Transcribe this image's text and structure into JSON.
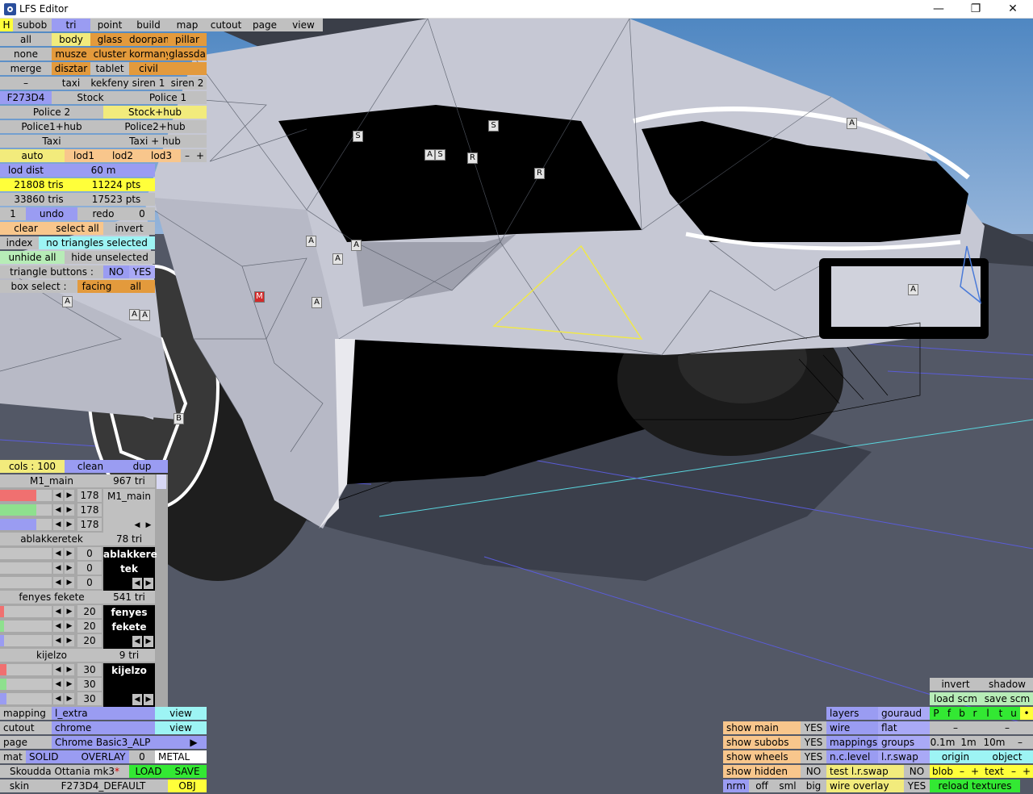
{
  "window": {
    "title": "LFS Editor",
    "minimize": "—",
    "maximize": "❐",
    "close": "✕"
  },
  "colors": {
    "grey": "#c0c0c0",
    "blue": "#9a9cf2",
    "orange": "#e39a3c",
    "yellow": "#f2eb7c",
    "cyan": "#9df4f4",
    "green": "#33e833"
  },
  "menu": {
    "h": "H",
    "subob": "subob",
    "tri": "tri",
    "point": "point",
    "build": "build",
    "map": "map",
    "cutout": "cutout",
    "page": "page",
    "view": "view"
  },
  "subobs": {
    "row1": [
      "all",
      "body",
      "glass",
      "doorpan",
      "pillar"
    ],
    "row2": [
      "none",
      "musze",
      "cluster",
      "kormany",
      "glassda"
    ],
    "row3": [
      "merge",
      "disztar",
      "tablet",
      "civil",
      ""
    ],
    "row4": [
      "–",
      "taxi",
      "kekfeny",
      "siren 1",
      "siren 2"
    ]
  },
  "skins": {
    "code": "F273D4",
    "stock": "Stock",
    "police1": "Police 1",
    "police2": "Police 2",
    "stockhub": "Stock+hub",
    "police1hub": "Police1+hub",
    "police2hub": "Police2+hub",
    "taxi": "Taxi",
    "taxihub": "Taxi + hub"
  },
  "lod": {
    "auto": "auto",
    "lod1": "lod1",
    "lod2": "lod2",
    "lod3": "lod3",
    "minus": "–",
    "plus": "+",
    "dist_label": "lod dist",
    "dist_value": "60 m"
  },
  "stats": {
    "tris1": "21808 tris",
    "pts1": "11224 pts",
    "tris2": "33860 tris",
    "pts2": "17523 pts"
  },
  "undo": {
    "count": "1",
    "undo": "undo",
    "redo": "redo",
    "redo_count": "0"
  },
  "select": {
    "clear": "clear",
    "select_all": "select all",
    "invert": "invert",
    "index": "index",
    "status": "no triangles selected",
    "unhide_all": "unhide all",
    "hide_unselected": "hide unselected",
    "tri_buttons": "triangle buttons :",
    "no": "NO",
    "yes": "YES",
    "box_select": "box select :",
    "facing": "facing",
    "all": "all"
  },
  "viewport_labels": {
    "s": "S",
    "a": "A",
    "r": "R",
    "m": "M",
    "b": "B"
  },
  "materials_header": {
    "cols": "cols : 100",
    "clean": "clean",
    "dup": "dup"
  },
  "materials": [
    {
      "name": "M1_main",
      "tris": "967 tri",
      "r": "178",
      "g": "178",
      "b": "178",
      "swatch": "M1_main",
      "dark": false,
      "level": 0.7
    },
    {
      "name": "ablakkeretek",
      "tris": "78 tri",
      "r": "0",
      "g": "0",
      "b": "0",
      "swatch": "ablakkere tek",
      "dark": true,
      "level": 0
    },
    {
      "name": "fenyes fekete",
      "tris": "541 tri",
      "r": "20",
      "g": "20",
      "b": "20",
      "swatch": "fenyes fekete",
      "dark": true,
      "level": 0.08
    },
    {
      "name": "kijelzo",
      "tris": "9 tri",
      "r": "30",
      "g": "30",
      "b": "30",
      "swatch": "kijelzo",
      "dark": true,
      "level": 0.12
    }
  ],
  "props": {
    "mapping": "mapping",
    "mapping_val": "l_extra",
    "view": "view",
    "cutout": "cutout",
    "cutout_val": "chrome",
    "view2": "view",
    "page": "page",
    "page_val": "Chrome Basic3_ALP",
    "page_arrow": "▶",
    "mat": "mat",
    "solid": "SOLID",
    "overlay": "OVERLAY",
    "zero": "0",
    "metal": "METAL",
    "car": "Skoudda Ottania mk3",
    "star": "*",
    "load": "LOAD",
    "save": "SAVE",
    "skin": "skin",
    "skin_val": "F273D4_DEFAULT",
    "obj": "OBJ"
  },
  "display": {
    "show_main": "show main",
    "show_subobs": "show subobs",
    "show_wheels": "show wheels",
    "show_hidden": "show hidden",
    "yes": "YES",
    "no": "NO",
    "nrm": "nrm",
    "off": "off",
    "sml": "sml",
    "big": "big",
    "layers": "layers",
    "gouraud": "gouraud",
    "wire": "wire",
    "flat": "flat",
    "mappings": "mappings",
    "groups": "groups",
    "nclevel": "n.c.level",
    "lrswap": "l.r.swap",
    "test_lrswap": "test l.r.swap",
    "wire_overlay": "wire overlay",
    "invert": "invert",
    "shadow": "shadow",
    "load_scm": "load scm",
    "save_scm": "save scm",
    "letters": [
      "P",
      "f",
      "b",
      "r",
      "l",
      "t",
      "u",
      "•"
    ],
    "dash": "–",
    "d01": "0.1m",
    "d1": "1m",
    "d10": "10m",
    "origin": "origin",
    "object": "object",
    "blob": "blob",
    "minus": "–",
    "plus": "+",
    "text": "text",
    "reload": "reload textures"
  }
}
